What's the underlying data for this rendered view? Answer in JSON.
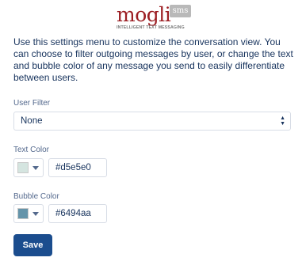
{
  "brand": {
    "name": "mogli",
    "badge": "sms",
    "tagline": "INTELLIGENT TEXT MESSAGING"
  },
  "description": "Use this settings menu to customize the conversation view. You can choose to filter outgoing messages by user, or change the text and bubble color of any message you send to easily differentiate between users.",
  "user_filter": {
    "label": "User Filter",
    "selected": "None"
  },
  "text_color": {
    "label": "Text Color",
    "value": "#d5e5e0",
    "swatch": "#d5e5e0"
  },
  "bubble_color": {
    "label": "Bubble Color",
    "value": "#6494aa",
    "swatch": "#6494aa"
  },
  "save_label": "Save",
  "icons": {
    "select": "up-down-arrows-icon",
    "picker": "chevron-down-icon"
  }
}
